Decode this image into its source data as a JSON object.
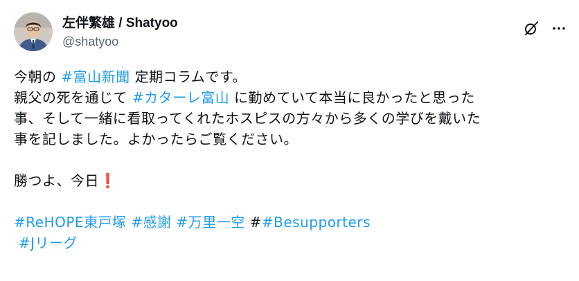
{
  "author": {
    "display_name": "左伴繁雄 / Shatyoo",
    "handle": "@shatyoo"
  },
  "icons": {
    "grok": "grok-icon",
    "more": "more-icon",
    "exclaim": "❗"
  },
  "colors": {
    "link": "#1d9bf0",
    "text": "#0f1419",
    "muted": "#536471",
    "exclaim": "#e0245e"
  },
  "post": {
    "line1": {
      "pre": "今朝の ",
      "tag": "#富山新聞",
      "post": " 定期コラムです。"
    },
    "line2": {
      "pre": "親父の死を通じて ",
      "tag": "#カターレ富山",
      "post": " に勤めていて本当に良かったと思った"
    },
    "line3": "事、そして一緒に看取ってくれたホスピスの方々から多くの学びを戴いた",
    "line4": "事を記しました。よかったらご覧ください。",
    "line5": {
      "text": "勝つよ、今日"
    },
    "hashtags_line": {
      "tag1": "#ReHOPE東戸塚",
      "tag2": "#感謝",
      "tag3": "#万里一空",
      "prefix4": "#",
      "tag4": "#Besupporters"
    },
    "last_tag": "#Jリーグ"
  }
}
